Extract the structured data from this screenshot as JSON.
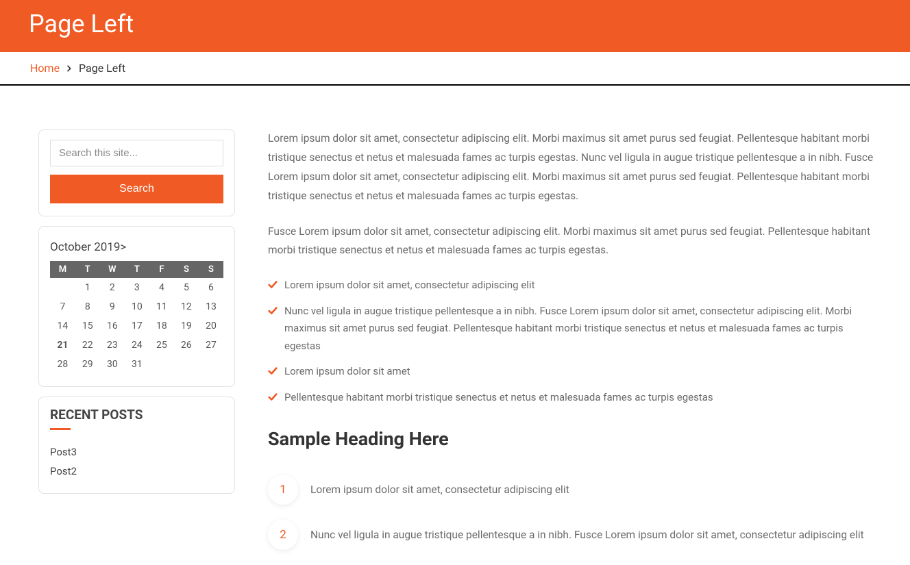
{
  "header": {
    "title": "Page Left"
  },
  "breadcrumb": {
    "home": "Home",
    "current": "Page Left"
  },
  "search": {
    "placeholder": "Search this site...",
    "button": "Search"
  },
  "calendar": {
    "caption": "October 2019>",
    "dow": [
      "M",
      "T",
      "W",
      "T",
      "F",
      "S",
      "S"
    ],
    "weeks": [
      [
        "",
        "1",
        "2",
        "3",
        "4",
        "5",
        "6"
      ],
      [
        "7",
        "8",
        "9",
        "10",
        "11",
        "12",
        "13"
      ],
      [
        "14",
        "15",
        "16",
        "17",
        "18",
        "19",
        "20"
      ],
      [
        "21",
        "22",
        "23",
        "24",
        "25",
        "26",
        "27"
      ],
      [
        "28",
        "29",
        "30",
        "31",
        "",
        "",
        ""
      ]
    ],
    "today": "21"
  },
  "recent": {
    "title": "RECENT POSTS",
    "items": [
      "Post3",
      "Post2"
    ]
  },
  "content": {
    "p1": "Lorem ipsum dolor sit amet, consectetur adipiscing elit. Morbi maximus sit amet purus sed feugiat. Pellentesque habitant morbi tristique senectus et netus et malesuada fames ac turpis egestas. Nunc vel ligula in augue tristique pellentesque a in nibh. Fusce Lorem ipsum dolor sit amet, consectetur adipiscing elit. Morbi maximus sit amet purus sed feugiat. Pellentesque habitant morbi tristique senectus et netus et malesuada fames ac turpis egestas.",
    "p2": "Fusce Lorem ipsum dolor sit amet, consectetur adipiscing elit. Morbi maximus sit amet purus sed feugiat. Pellentesque habitant morbi tristique senectus et netus et malesuada fames ac turpis egestas.",
    "checks": [
      "Lorem ipsum dolor sit amet, consectetur adipiscing elit",
      "Nunc vel ligula in augue tristique pellentesque a in nibh. Fusce Lorem ipsum dolor sit amet, consectetur adipiscing elit. Morbi maximus sit amet purus sed feugiat. Pellentesque habitant morbi tristique senectus et netus et malesuada fames ac turpis egestas",
      "Lorem ipsum dolor sit amet",
      "Pellentesque habitant morbi tristique senectus et netus et malesuada fames ac turpis egestas"
    ],
    "h2": "Sample Heading Here",
    "nums": [
      {
        "n": "1",
        "t": "Lorem ipsum dolor sit amet, consectetur adipiscing elit"
      },
      {
        "n": "2",
        "t": "Nunc vel ligula in augue tristique pellentesque a in nibh. Fusce Lorem ipsum dolor sit amet, consectetur adipiscing elit"
      }
    ]
  }
}
